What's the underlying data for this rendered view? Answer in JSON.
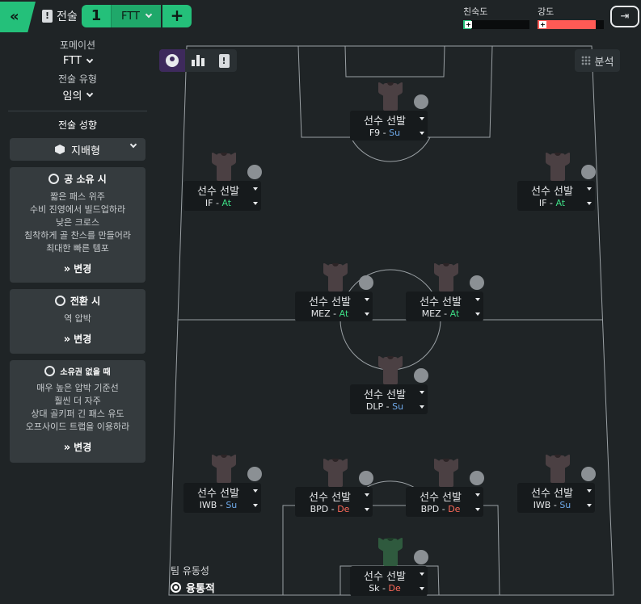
{
  "header": {
    "back_icon": "«",
    "tactic_label": "전술",
    "slot_number": "1",
    "formation_short": "FTT",
    "add_icon": "+",
    "familiarity_label": "친숙도",
    "familiarity_value": 0.12,
    "familiarity_color": "#24c07a",
    "intensity_label": "강도",
    "intensity_value": 0.88,
    "intensity_color": "#ff5a55",
    "exit_icon": "⇥"
  },
  "sidebar": {
    "formation_label": "포메이션",
    "formation_value": "FTT",
    "tactic_type_label": "전술 유형",
    "tactic_type_value": "임의",
    "mentality_label": "전술 성향",
    "mentality_value": "지배형",
    "panels": [
      {
        "title": "공 소유 시",
        "icon": "ball-icon",
        "lines": [
          "짧은 패스 위주",
          "수비 진영에서 빌드업하라",
          "낮은 크로스",
          "침착하게 골 찬스를 만들어라",
          "최대한 빠른 템포"
        ],
        "button": "변경"
      },
      {
        "title": "전환 시",
        "icon": "transition-icon",
        "lines": [
          "역 압박"
        ],
        "button": "변경"
      },
      {
        "title": "소유권 없을 때",
        "icon": "shield-icon",
        "lines": [
          "매우 높은 압박 기준선",
          "훨씬 더 자주",
          "상대 골키퍼 긴 패스 유도",
          "오프사이드 트랩을 이용하라"
        ],
        "button": "변경"
      }
    ]
  },
  "pitch": {
    "analysis_label": "분석",
    "team_fluidity_label": "팀 유동성",
    "team_fluidity_value": "융통적",
    "players": [
      {
        "name": "선수 선발",
        "role": "F9",
        "duty": "Su",
        "duty_class": "duty-su",
        "pos": "f9"
      },
      {
        "name": "선수 선발",
        "role": "IF",
        "duty": "At",
        "duty_class": "duty-at",
        "pos": "ifl"
      },
      {
        "name": "선수 선발",
        "role": "IF",
        "duty": "At",
        "duty_class": "duty-at",
        "pos": "ifr"
      },
      {
        "name": "선수 선발",
        "role": "MEZ",
        "duty": "At",
        "duty_class": "duty-at",
        "pos": "mezl"
      },
      {
        "name": "선수 선발",
        "role": "MEZ",
        "duty": "At",
        "duty_class": "duty-at",
        "pos": "mezr"
      },
      {
        "name": "선수 선발",
        "role": "DLP",
        "duty": "Su",
        "duty_class": "duty-su",
        "pos": "dlp"
      },
      {
        "name": "선수 선발",
        "role": "IWB",
        "duty": "Su",
        "duty_class": "duty-su",
        "pos": "iwbl"
      },
      {
        "name": "선수 선발",
        "role": "BPD",
        "duty": "De",
        "duty_class": "duty-de",
        "pos": "bpdl"
      },
      {
        "name": "선수 선발",
        "role": "BPD",
        "duty": "De",
        "duty_class": "duty-de",
        "pos": "bpdr"
      },
      {
        "name": "선수 선발",
        "role": "IWB",
        "duty": "Su",
        "duty_class": "duty-su",
        "pos": "iwbr"
      },
      {
        "name": "선수 선발",
        "role": "Sk",
        "duty": "De",
        "duty_class": "duty-de",
        "pos": "gk"
      }
    ]
  }
}
